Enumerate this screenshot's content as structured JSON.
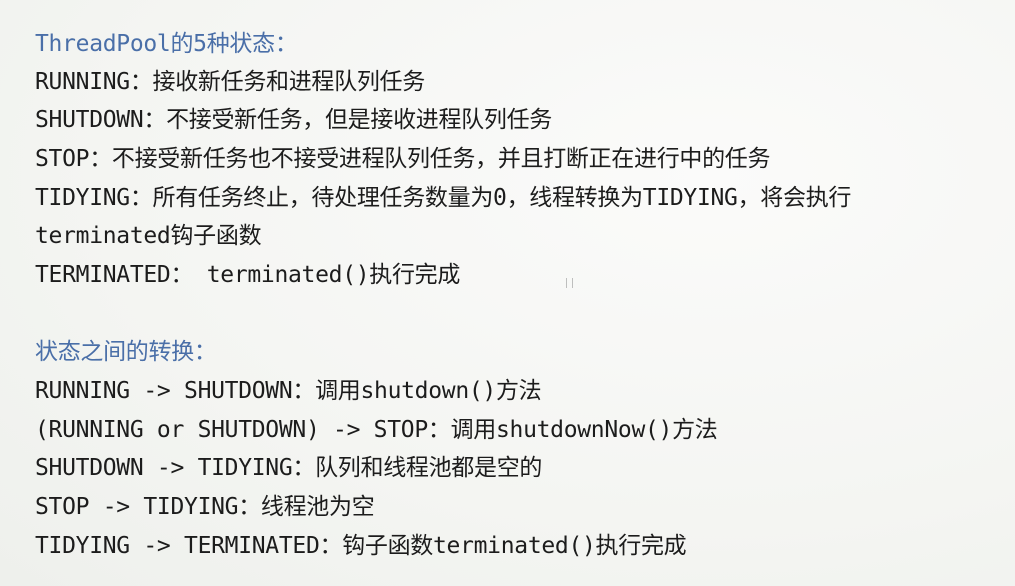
{
  "section1": {
    "heading": "ThreadPool的5种状态：",
    "lines": [
      "RUNNING：接收新任务和进程队列任务",
      "SHUTDOWN：不接受新任务，但是接收进程队列任务",
      "STOP：不接受新任务也不接受进程队列任务，并且打断正在进行中的任务",
      "TIDYING：所有任务终止，待处理任务数量为0，线程转换为TIDYING，将会执行",
      "terminated钩子函数",
      "TERMINATED：  terminated()执行完成"
    ]
  },
  "section2": {
    "heading": "状态之间的转换：",
    "lines": [
      "RUNNING -> SHUTDOWN：调用shutdown()方法",
      "(RUNNING or SHUTDOWN) -> STOP：调用shutdownNow()方法",
      "SHUTDOWN -> TIDYING：队列和线程池都是空的",
      "STOP -> TIDYING：线程池为空",
      "TIDYING -> TERMINATED：钩子函数terminated()执行完成"
    ]
  },
  "colors": {
    "heading": "#4a6fa8",
    "text": "#1c1c1c",
    "background": "#f7f8f6"
  }
}
